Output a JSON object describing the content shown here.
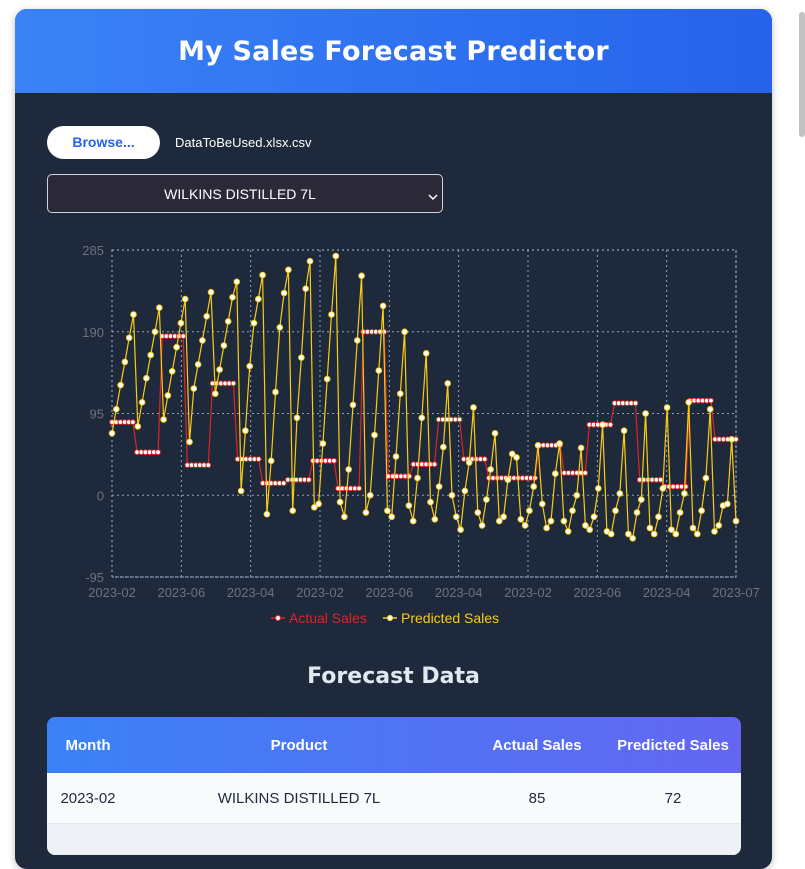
{
  "app": {
    "title": "My Sales Forecast Predictor"
  },
  "upload": {
    "browse_label": "Browse...",
    "file_name": "DataToBeUsed.xlsx.csv"
  },
  "product_select": {
    "selected": "WILKINS DISTILLED 7L"
  },
  "chart_data": {
    "type": "line",
    "x_tick_labels": [
      "2023-02",
      "2023-06",
      "2023-04",
      "2023-02",
      "2023-06",
      "2023-04",
      "2023-02",
      "2023-06",
      "2023-04",
      "2023-07"
    ],
    "y_ticks": [
      285,
      190,
      95,
      0,
      -95
    ],
    "ylim": [
      -95,
      285
    ],
    "grid": true,
    "legend_position": "bottom",
    "series": [
      {
        "name": "Actual Sales",
        "color": "#dc2626",
        "values": [
          85,
          85,
          85,
          85,
          85,
          85,
          50,
          50,
          50,
          50,
          50,
          50,
          185,
          185,
          185,
          185,
          185,
          185,
          35,
          35,
          35,
          35,
          35,
          35,
          130,
          130,
          130,
          130,
          130,
          130,
          42,
          42,
          42,
          42,
          42,
          42,
          14,
          14,
          14,
          14,
          14,
          14,
          18,
          18,
          18,
          18,
          18,
          18,
          40,
          40,
          40,
          40,
          40,
          40,
          8,
          8,
          8,
          8,
          8,
          8,
          190,
          190,
          190,
          190,
          190,
          190,
          22,
          22,
          22,
          22,
          22,
          22,
          36,
          36,
          36,
          36,
          36,
          36,
          88,
          88,
          88,
          88,
          88,
          88,
          42,
          42,
          42,
          42,
          42,
          42,
          20,
          20,
          20,
          20,
          20,
          20,
          20,
          20,
          20,
          20,
          20,
          20,
          58,
          58,
          58,
          58,
          58,
          58,
          26,
          26,
          26,
          26,
          26,
          26,
          82,
          82,
          82,
          82,
          82,
          82,
          107,
          107,
          107,
          107,
          107,
          107,
          18,
          18,
          18,
          18,
          18,
          18,
          10,
          10,
          10,
          10,
          10,
          10,
          110,
          110,
          110,
          110,
          110,
          110,
          65,
          65,
          65,
          65,
          65,
          65
        ]
      },
      {
        "name": "Predicted Sales",
        "color": "#facc15",
        "values": [
          72,
          100,
          128,
          155,
          183,
          210,
          80,
          108,
          136,
          163,
          190,
          218,
          88,
          116,
          144,
          172,
          200,
          228,
          62,
          124,
          152,
          180,
          208,
          236,
          118,
          146,
          174,
          202,
          230,
          248,
          5,
          75,
          150,
          200,
          228,
          256,
          -22,
          40,
          120,
          195,
          235,
          262,
          -18,
          90,
          160,
          240,
          272,
          -14,
          -10,
          60,
          135,
          210,
          278,
          -8,
          -25,
          30,
          105,
          180,
          255,
          -20,
          0,
          70,
          145,
          220,
          -18,
          -25,
          45,
          118,
          190,
          -12,
          -30,
          20,
          90,
          165,
          -8,
          -28,
          10,
          56,
          130,
          0,
          -25,
          -40,
          5,
          38,
          102,
          -20,
          -35,
          -5,
          30,
          72,
          -30,
          -25,
          18,
          48,
          44,
          -28,
          -35,
          -18,
          10,
          58,
          -10,
          -38,
          -30,
          25,
          60,
          -30,
          -42,
          -18,
          0,
          55,
          -35,
          -40,
          -25,
          8,
          82,
          -42,
          -45,
          -18,
          2,
          75,
          -45,
          -50,
          -20,
          -5,
          95,
          -38,
          -45,
          -25,
          8,
          102,
          -40,
          -45,
          -20,
          2,
          108,
          -38,
          -45,
          -18,
          20,
          100,
          -42,
          -35,
          -12,
          -10,
          65,
          -30
        ]
      }
    ]
  },
  "forecast": {
    "title": "Forecast Data",
    "columns": [
      "Month",
      "Product",
      "Actual Sales",
      "Predicted Sales"
    ],
    "rows": [
      {
        "month": "2023-02",
        "product": "WILKINS DISTILLED 7L",
        "actual": "85",
        "predicted": "72"
      }
    ]
  }
}
